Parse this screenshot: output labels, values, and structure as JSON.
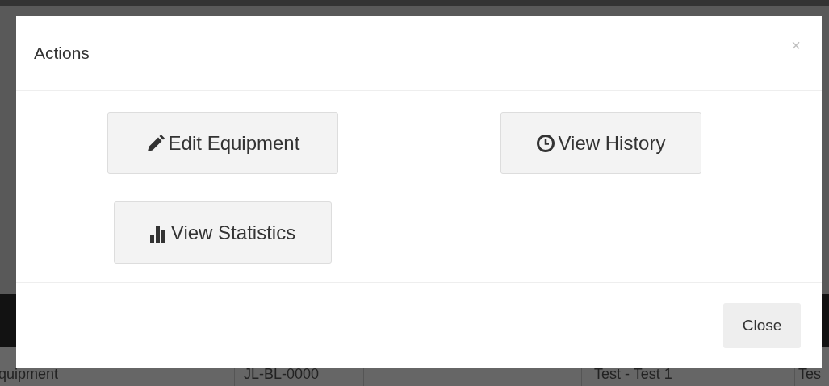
{
  "background_table": {
    "row": [
      "quipment",
      "JL-BL-0000",
      "Test - Test 1",
      "Tes"
    ]
  },
  "modal": {
    "title": "Actions",
    "close_icon": "×",
    "actions": [
      {
        "label": "Edit Equipment",
        "kind": "edit"
      },
      {
        "label": "View History",
        "kind": "history"
      },
      {
        "label": "View Statistics",
        "kind": "statistics"
      }
    ],
    "footer_buttons": [
      "Close"
    ]
  }
}
